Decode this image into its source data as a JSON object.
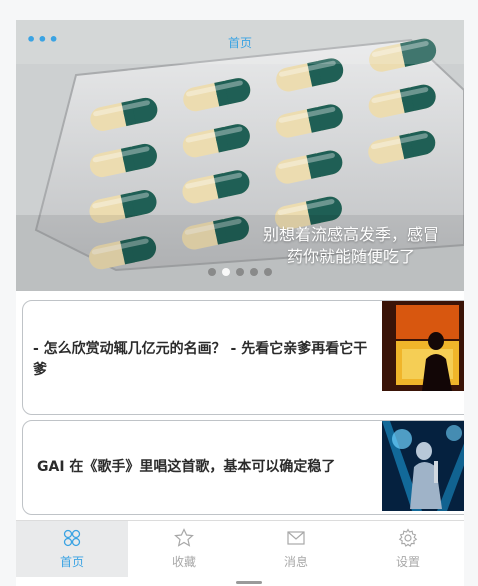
{
  "header": {
    "menu_icon": "more-icon",
    "menu_glyph": "•••",
    "title": "首页"
  },
  "banner": {
    "caption": "别想着流感高发季，感冒药你就能随便吃了",
    "dots_total": 5,
    "active_dot": 2
  },
  "news": [
    {
      "title": "- 怎么欣赏动辄几亿元的名画？ - 先看它亲爹再看它干爹",
      "thumbnail_icon": "painting-thumbnail"
    },
    {
      "title": "GAI 在《歌手》里唱这首歌，基本可以确定稳了",
      "thumbnail_icon": "concert-thumbnail"
    }
  ],
  "tabbar": {
    "items": [
      {
        "label": "首页",
        "icon": "home-icon",
        "active": true
      },
      {
        "label": "收藏",
        "icon": "star-icon",
        "active": false
      },
      {
        "label": "消息",
        "icon": "mail-icon",
        "active": false
      },
      {
        "label": "设置",
        "icon": "gear-icon",
        "active": false
      }
    ]
  },
  "colors": {
    "accent": "#3aa3e3",
    "inactive": "#a8a8a8",
    "card_border": "#bfc3c7"
  }
}
